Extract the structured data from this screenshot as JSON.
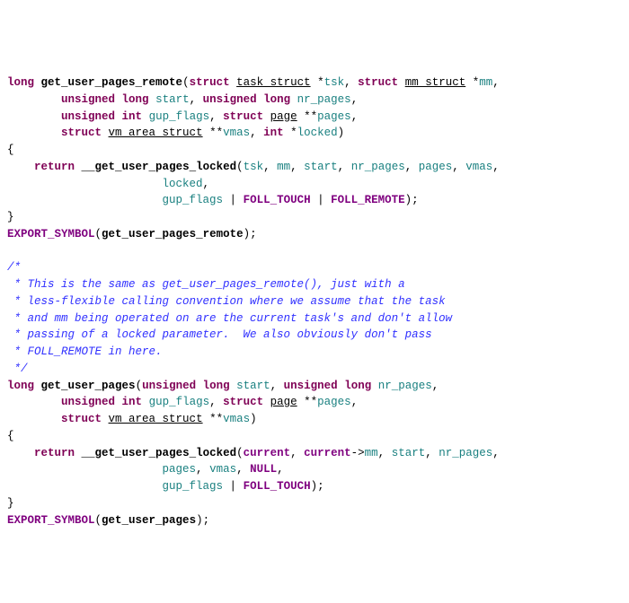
{
  "l1_long": "long",
  "l1_fn": "get_user_pages_remote",
  "l1_struct1": "struct",
  "l1_ts": "task_struct",
  "l1_tsk": "tsk",
  "l1_struct2": "struct",
  "l1_ms": "mm_struct",
  "l1_mm": "mm",
  "l2_ul1": "unsigned",
  "l2_ul2": "long",
  "l2_start": "start",
  "l2_ul3": "unsigned",
  "l2_ul4": "long",
  "l2_np": "nr_pages",
  "l3_ui1": "unsigned",
  "l3_ui2": "int",
  "l3_gf": "gup_flags",
  "l3_struct": "struct",
  "l3_page": "page",
  "l3_pp": "pages",
  "l4_struct": "struct",
  "l4_vas": "vm_area_struct",
  "l4_vmas": "vmas",
  "l4_int": "int",
  "l4_locked": "locked",
  "l6_ret": "return",
  "l6_fn": "__get_user_pages_locked",
  "l6_tsk": "tsk",
  "l6_mm": "mm",
  "l6_start": "start",
  "l6_np": "nr_pages",
  "l6_pages": "pages",
  "l6_vmas": "vmas",
  "l7_locked": "locked",
  "l8_gf": "gup_flags",
  "l8_ft": "FOLL_TOUCH",
  "l8_fr": "FOLL_REMOTE",
  "l10_exp": "EXPORT_SYMBOL",
  "l10_arg": "get_user_pages_remote",
  "c1": "/*",
  "c2": " * This is the same as get_user_pages_remote(), just with a",
  "c3": " * less-flexible calling convention where we assume that the task",
  "c4": " * and mm being operated on are the current task's and don't allow",
  "c5": " * passing of a locked parameter.  We also obviously don't pass",
  "c6": " * FOLL_REMOTE in here.",
  "c7": " */",
  "g1_long": "long",
  "g1_fn": "get_user_pages",
  "g1_ul1": "unsigned",
  "g1_ul2": "long",
  "g1_start": "start",
  "g1_ul3": "unsigned",
  "g1_ul4": "long",
  "g1_np": "nr_pages",
  "g2_ui1": "unsigned",
  "g2_ui2": "int",
  "g2_gf": "gup_flags",
  "g2_struct": "struct",
  "g2_page": "page",
  "g2_pp": "pages",
  "g3_struct": "struct",
  "g3_vas": "vm_area_struct",
  "g3_vmas": "vmas",
  "g5_ret": "return",
  "g5_fn": "__get_user_pages_locked",
  "g5_cur1": "current",
  "g5_cur2": "current",
  "g5_mm": "mm",
  "g5_start": "start",
  "g5_np": "nr_pages",
  "g6_pages": "pages",
  "g6_vmas": "vmas",
  "g6_null": "NULL",
  "g7_gf": "gup_flags",
  "g7_ft": "FOLL_TOUCH",
  "g9_exp": "EXPORT_SYMBOL",
  "g9_arg": "get_user_pages"
}
